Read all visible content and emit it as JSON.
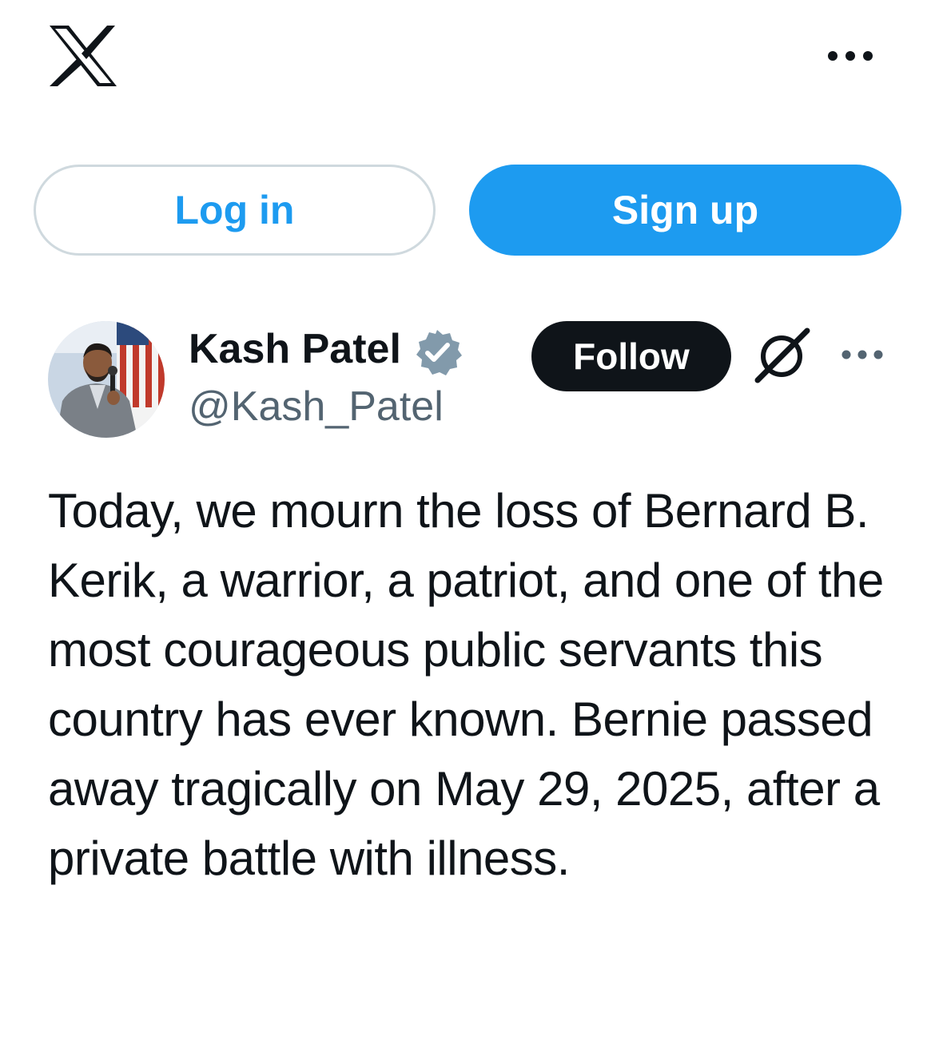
{
  "header": {
    "logo_icon": "x-logo-icon",
    "more_icon": "more-horizontal-icon"
  },
  "auth": {
    "login_label": "Log in",
    "signup_label": "Sign up"
  },
  "post": {
    "author": {
      "name": "Kash Patel",
      "handle": "@Kash_Patel",
      "verified": true,
      "avatar_icon": "profile-photo"
    },
    "follow_label": "Follow",
    "grok_icon": "grok-icon",
    "more_icon": "more-horizontal-icon",
    "text": "Today, we mourn the loss of Bernard B. Kerik, a warrior, a patriot, and one of the most courageous public servants this country has ever known. Bernie passed away tragically on May 29, 2025, after a private battle with illness."
  },
  "colors": {
    "brand_blue": "#1d9bf0",
    "text_primary": "#0f1419",
    "text_secondary": "#536471",
    "border": "#cfd9de",
    "verified_badge": "#829aab"
  }
}
